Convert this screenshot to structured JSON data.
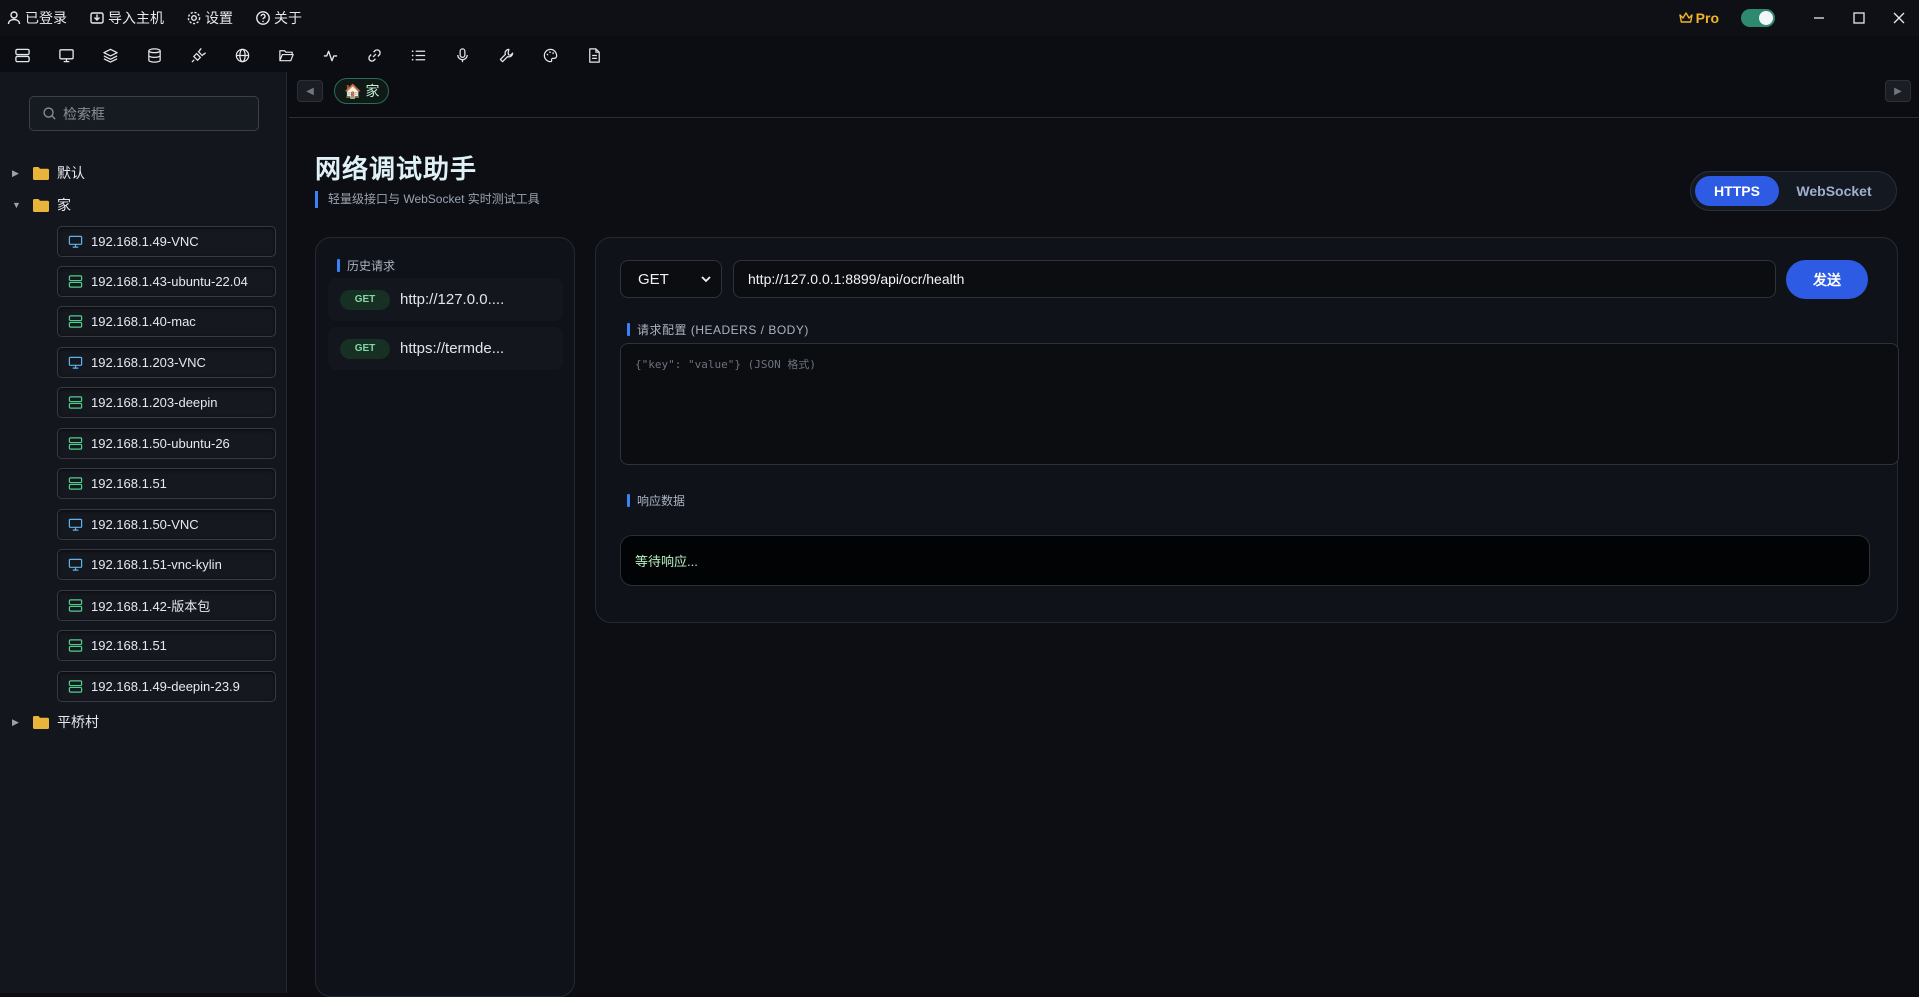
{
  "menu": {
    "logged_in": "已登录",
    "import_host": "导入主机",
    "settings": "设置",
    "about": "关于"
  },
  "titlebar": {
    "pro_label": "Pro",
    "theme_toggle_on": true
  },
  "toolbar_icons": [
    "server-icon",
    "monitor-icon",
    "layers-icon",
    "database-icon",
    "plug-icon",
    "globe-icon",
    "folder-open-icon",
    "activity-icon",
    "link-icon",
    "list-icon",
    "microphone-icon",
    "wrench-icon",
    "palette-icon",
    "document-icon"
  ],
  "sidebar": {
    "search_placeholder": "检索框",
    "groups": [
      {
        "label": "默认",
        "expanded": false
      },
      {
        "label": "家",
        "expanded": true
      },
      {
        "label": "平桥村",
        "expanded": false
      }
    ],
    "hosts": [
      {
        "label": "192.168.1.49-VNC",
        "type": "vnc"
      },
      {
        "label": "192.168.1.43-ubuntu-22.04",
        "type": "ssh"
      },
      {
        "label": "192.168.1.40-mac",
        "type": "ssh"
      },
      {
        "label": "192.168.1.203-VNC",
        "type": "vnc"
      },
      {
        "label": "192.168.1.203-deepin",
        "type": "ssh"
      },
      {
        "label": "192.168.1.50-ubuntu-26",
        "type": "ssh"
      },
      {
        "label": "192.168.1.51",
        "type": "ssh"
      },
      {
        "label": "192.168.1.50-VNC",
        "type": "vnc"
      },
      {
        "label": "192.168.1.51-vnc-kylin",
        "type": "vnc"
      },
      {
        "label": "192.168.1.42-版本包",
        "type": "ssh"
      },
      {
        "label": "192.168.1.51",
        "type": "ssh"
      },
      {
        "label": "192.168.1.49-deepin-23.9",
        "type": "ssh"
      }
    ]
  },
  "tabs": {
    "home_label": "家"
  },
  "main": {
    "title": "网络调试助手",
    "subtitle": "轻量级接口与 WebSocket 实时测试工具",
    "modes": {
      "https": "HTTPS",
      "websocket": "WebSocket",
      "active": "HTTPS"
    },
    "history": {
      "title": "历史请求",
      "items": [
        {
          "method": "GET",
          "url": "http://127.0.0...."
        },
        {
          "method": "GET",
          "url": "https://termde..."
        }
      ]
    },
    "request": {
      "method": "GET",
      "url": "http://127.0.0.1:8899/api/ocr/health",
      "send_label": "发送",
      "config_title": "请求配置 (HEADERS / BODY)",
      "body_placeholder": "{\"key\": \"value\"} (JSON 格式)"
    },
    "response": {
      "title": "响应数据",
      "text": "等待响应..."
    }
  }
}
